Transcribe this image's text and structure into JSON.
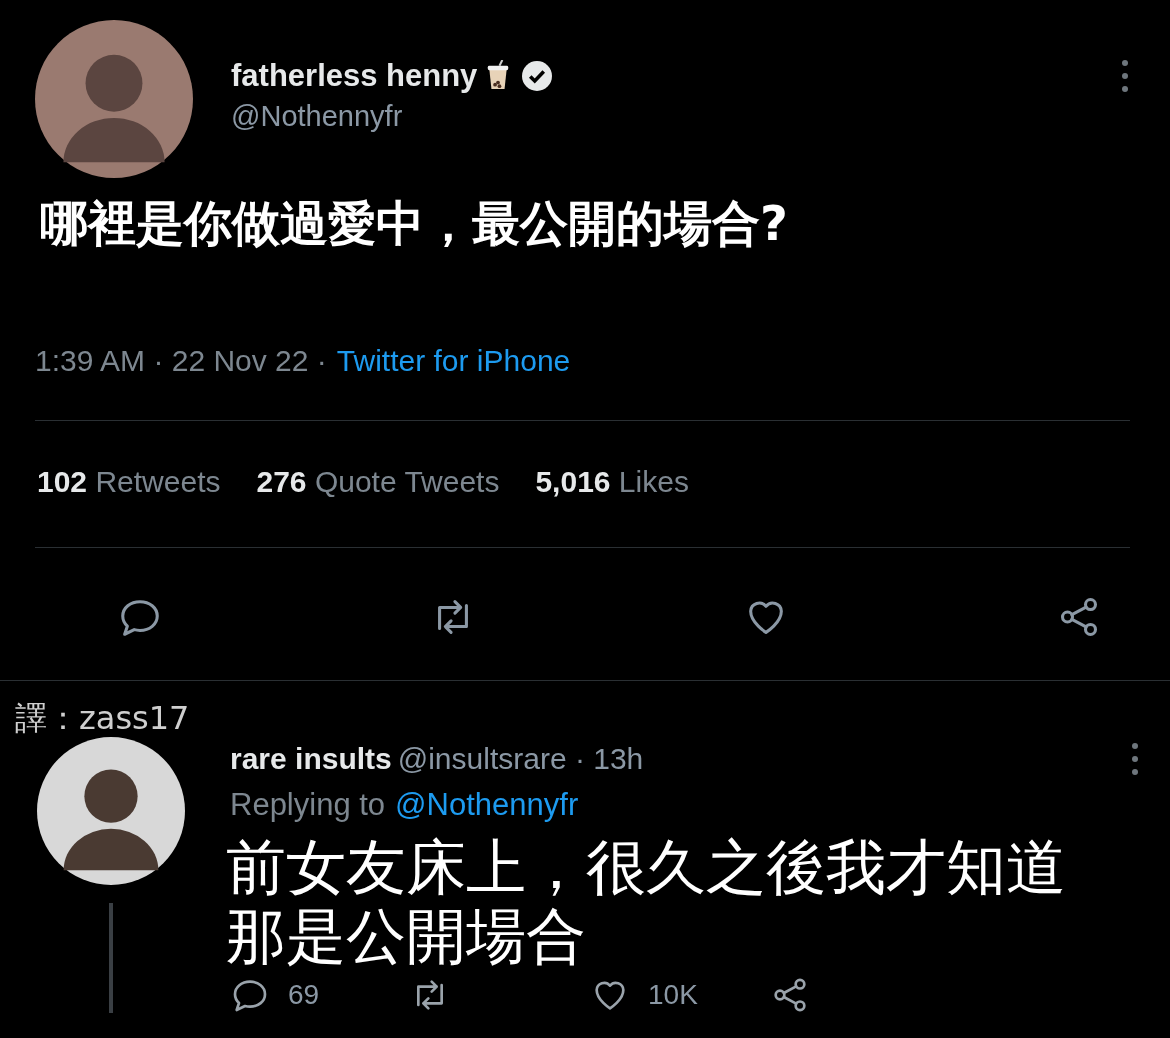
{
  "tweet": {
    "author_name": "fatherless henny",
    "handle": "@Nothennyfr",
    "verified": true,
    "text": "哪裡是你做過愛中，最公開的場合?",
    "timestamp": "1:39 AM · 22 Nov 22 ·",
    "source": "Twitter for iPhone",
    "stats": [
      {
        "count": "102",
        "label": "Retweets"
      },
      {
        "count": "276",
        "label": "Quote Tweets"
      },
      {
        "count": "5,016",
        "label": "Likes"
      }
    ],
    "actions": [
      {
        "kind": "reply"
      },
      {
        "kind": "retweet"
      },
      {
        "kind": "like"
      },
      {
        "kind": "share"
      }
    ]
  },
  "translator_credit": "譯：zass17",
  "reply": {
    "author_name": "rare insults",
    "meta": "@insultsrare · 13h",
    "replying_label": "Replying to",
    "replying_handle": "@Nothennyfr",
    "text": "前女友床上，很久之後我才知道那是公開場合",
    "actions": [
      {
        "kind": "reply",
        "count": "69"
      },
      {
        "kind": "retweet"
      },
      {
        "kind": "like",
        "count": "10K"
      },
      {
        "kind": "share"
      }
    ]
  }
}
